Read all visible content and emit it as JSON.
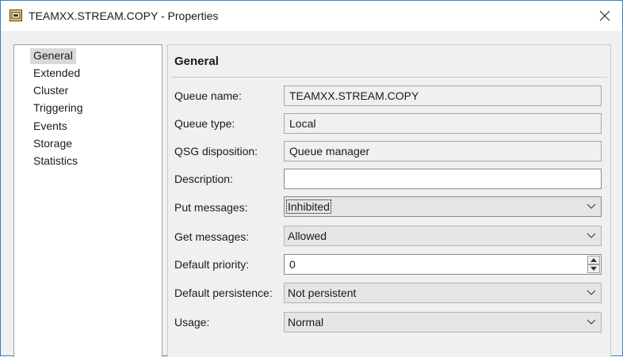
{
  "window": {
    "title": "TEAMXX.STREAM.COPY - Properties"
  },
  "nav": {
    "items": [
      {
        "label": "General",
        "selected": true
      },
      {
        "label": "Extended"
      },
      {
        "label": "Cluster"
      },
      {
        "label": "Triggering"
      },
      {
        "label": "Events"
      },
      {
        "label": "Storage"
      },
      {
        "label": "Statistics"
      }
    ]
  },
  "general": {
    "title": "General",
    "queue_name": {
      "label": "Queue name:",
      "value": "TEAMXX.STREAM.COPY"
    },
    "queue_type": {
      "label": "Queue type:",
      "value": "Local"
    },
    "qsg_disposition": {
      "label": "QSG disposition:",
      "value": "Queue manager"
    },
    "description": {
      "label": "Description:",
      "value": ""
    },
    "put_messages": {
      "label": "Put messages:",
      "value": "Inhibited"
    },
    "get_messages": {
      "label": "Get messages:",
      "value": "Allowed"
    },
    "default_priority": {
      "label": "Default priority:",
      "value": "0"
    },
    "default_persistence": {
      "label": "Default persistence:",
      "value": "Not persistent"
    },
    "usage": {
      "label": "Usage:",
      "value": "Normal"
    }
  },
  "colors": {
    "window_border": "#2a7fd4",
    "selected_nav": "#d9d9d9",
    "panel_bg": "#f0f0f0"
  }
}
